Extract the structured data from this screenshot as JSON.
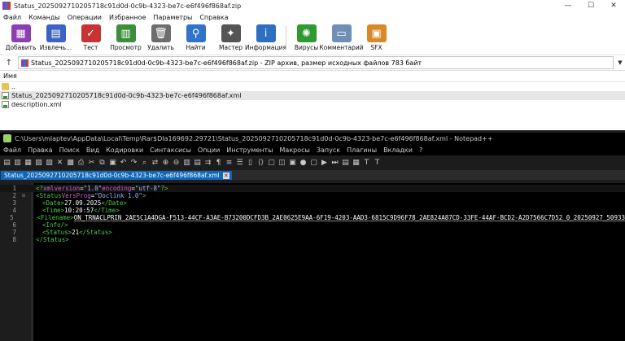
{
  "winrar": {
    "title": "Status_2025092710205718c91d0d-0c9b-4323-be7c-e6f496f868af.zip",
    "controls": [
      "—",
      "☐",
      "✕"
    ],
    "menu": [
      "Файл",
      "Команды",
      "Операции",
      "Избранное",
      "Параметры",
      "Справка"
    ],
    "toolbar": [
      {
        "label": "Добавить",
        "icon": "add-archive-icon",
        "color": "#8b3fb0",
        "glyph": "▦"
      },
      {
        "label": "Извлечь...",
        "icon": "extract-icon",
        "color": "#3a63c4",
        "glyph": "▤"
      },
      {
        "label": "Тест",
        "icon": "test-icon",
        "color": "#c93232",
        "glyph": "✓"
      },
      {
        "label": "Просмотр",
        "icon": "view-icon",
        "color": "#3b8e3b",
        "glyph": "▥"
      },
      {
        "label": "Удалить",
        "icon": "delete-icon",
        "color": "#6d6d6d",
        "glyph": "🗑"
      },
      {
        "label": "Найти",
        "icon": "find-icon",
        "color": "#2f74c9",
        "glyph": "⚲"
      },
      {
        "label": "Мастер",
        "icon": "wizard-icon",
        "color": "#555555",
        "glyph": "✦"
      },
      {
        "label": "Информация",
        "icon": "info-icon",
        "color": "#2e6fc0",
        "glyph": "i"
      },
      {
        "label": "Вирусы",
        "icon": "virus-icon",
        "color": "#2f9a2f",
        "glyph": "✺"
      },
      {
        "label": "Комментарий",
        "icon": "comment-icon",
        "color": "#6f8fb5",
        "glyph": "▭"
      },
      {
        "label": "SFX",
        "icon": "sfx-icon",
        "color": "#d68a2a",
        "glyph": "▣"
      }
    ],
    "address": "Status_2025092710205718c91d0d-0c9b-4323-be7c-e6f496f868af.zip - ZIP архив, размер исходных файлов 783 байт",
    "column_name": "Имя",
    "files": [
      {
        "name": "..",
        "type": "folder"
      },
      {
        "name": "Status_2025092710205718c91d0d-0c9b-4323-be7c-e6f496f868af.xml",
        "type": "xml"
      },
      {
        "name": "description.xml",
        "type": "xml"
      }
    ]
  },
  "npp": {
    "title": "C:\\Users\\mlaptev\\AppData\\Local\\Temp\\Rar$DIa169692.29721\\Status_2025092710205718c91d0d-0c9b-4323-be7c-e6f496f868af.xml - Notepad++",
    "menu": [
      "Файл",
      "Правка",
      "Поиск",
      "Вид",
      "Кодировки",
      "Синтаксисы",
      "Опции",
      "Инструменты",
      "Макросы",
      "Запуск",
      "Плагины",
      "Вкладки",
      "?"
    ],
    "toolbar_glyphs": [
      "▤",
      "▥",
      "▦",
      "▧",
      "▨",
      "✕",
      "▩",
      "⎙",
      "✂",
      "⧉",
      "▣",
      "↶",
      "↷",
      "⌕",
      "⇄",
      "⊕",
      "⊖",
      "▥",
      "▤",
      "⇉",
      "¶",
      "≡",
      "☰",
      "▯",
      "⟨⟩",
      "▢",
      "◫",
      "▣",
      "●",
      "▢",
      "▶",
      "⏭",
      "▤",
      "▦",
      "T",
      "T"
    ],
    "tab_label": "Status_2025092710205718c91d0d-0c9b-4323-be7c-e6f496f868af.xml",
    "tab_close": "✕",
    "lines": [
      {
        "num": "1",
        "fold": "",
        "parts": [
          [
            "c-br",
            "<?"
          ],
          [
            "c-pi",
            "xml "
          ],
          [
            "c-at",
            "version"
          ],
          [
            "c-tx",
            "="
          ],
          [
            "c-val",
            "\"1.0\" "
          ],
          [
            "c-at",
            "encoding"
          ],
          [
            "c-tx",
            "="
          ],
          [
            "c-val",
            "\"utf-8\""
          ],
          [
            "c-br",
            "?>"
          ]
        ]
      },
      {
        "num": "2",
        "fold": "⊟",
        "parts": [
          [
            "c-br",
            "<"
          ],
          [
            "c-tag",
            "Status "
          ],
          [
            "c-at",
            "VersProg"
          ],
          [
            "c-tx",
            "="
          ],
          [
            "c-val",
            "\"Doclink 1.0\""
          ],
          [
            "c-br",
            ">"
          ]
        ]
      },
      {
        "num": "3",
        "fold": "",
        "indent": 1,
        "parts": [
          [
            "c-br",
            "<"
          ],
          [
            "c-tag",
            "Date"
          ],
          [
            "c-br",
            ">"
          ],
          [
            "c-tx",
            "27.09.2025"
          ],
          [
            "c-br",
            "</"
          ],
          [
            "c-tag",
            "Date"
          ],
          [
            "c-br",
            ">"
          ]
        ]
      },
      {
        "num": "4",
        "fold": "",
        "indent": 1,
        "parts": [
          [
            "c-br",
            "<"
          ],
          [
            "c-tag",
            "Time"
          ],
          [
            "c-br",
            ">"
          ],
          [
            "c-tx",
            "10:20:57"
          ],
          [
            "c-br",
            "</"
          ],
          [
            "c-tag",
            "Time"
          ],
          [
            "c-br",
            ">"
          ]
        ]
      },
      {
        "num": "5",
        "fold": "",
        "indent": 1,
        "parts": [
          [
            "c-br",
            "<"
          ],
          [
            "c-tag",
            "Filename"
          ],
          [
            "c-br",
            ">"
          ],
          [
            "c-tx c-ul",
            "ON_TRNACLPRIN_2AE5C1A4DGA-F513-44CF-A3AE-B73200DCFD3B_2AE0625E9AA-6F19-4203-AAD3-6815C9D96F78_2AE824A87CD-33FE-44AF-BCD2-A2D7566C7D52_0_20250927_50933"
          ]
        ]
      },
      {
        "num": "6",
        "fold": "",
        "indent": 1,
        "parts": [
          [
            "c-br",
            "<"
          ],
          [
            "c-tag",
            "Info "
          ],
          [
            "c-br",
            "/>"
          ]
        ]
      },
      {
        "num": "7",
        "fold": "",
        "indent": 1,
        "parts": [
          [
            "c-br",
            "<"
          ],
          [
            "c-tag",
            "Status"
          ],
          [
            "c-br",
            ">"
          ],
          [
            "c-tx",
            "21"
          ],
          [
            "c-br",
            "</"
          ],
          [
            "c-tag",
            "Status"
          ],
          [
            "c-br",
            ">"
          ]
        ]
      },
      {
        "num": "8",
        "fold": "",
        "parts": [
          [
            "c-br",
            "</"
          ],
          [
            "c-tag",
            "Status"
          ],
          [
            "c-br",
            ">"
          ]
        ]
      }
    ]
  }
}
